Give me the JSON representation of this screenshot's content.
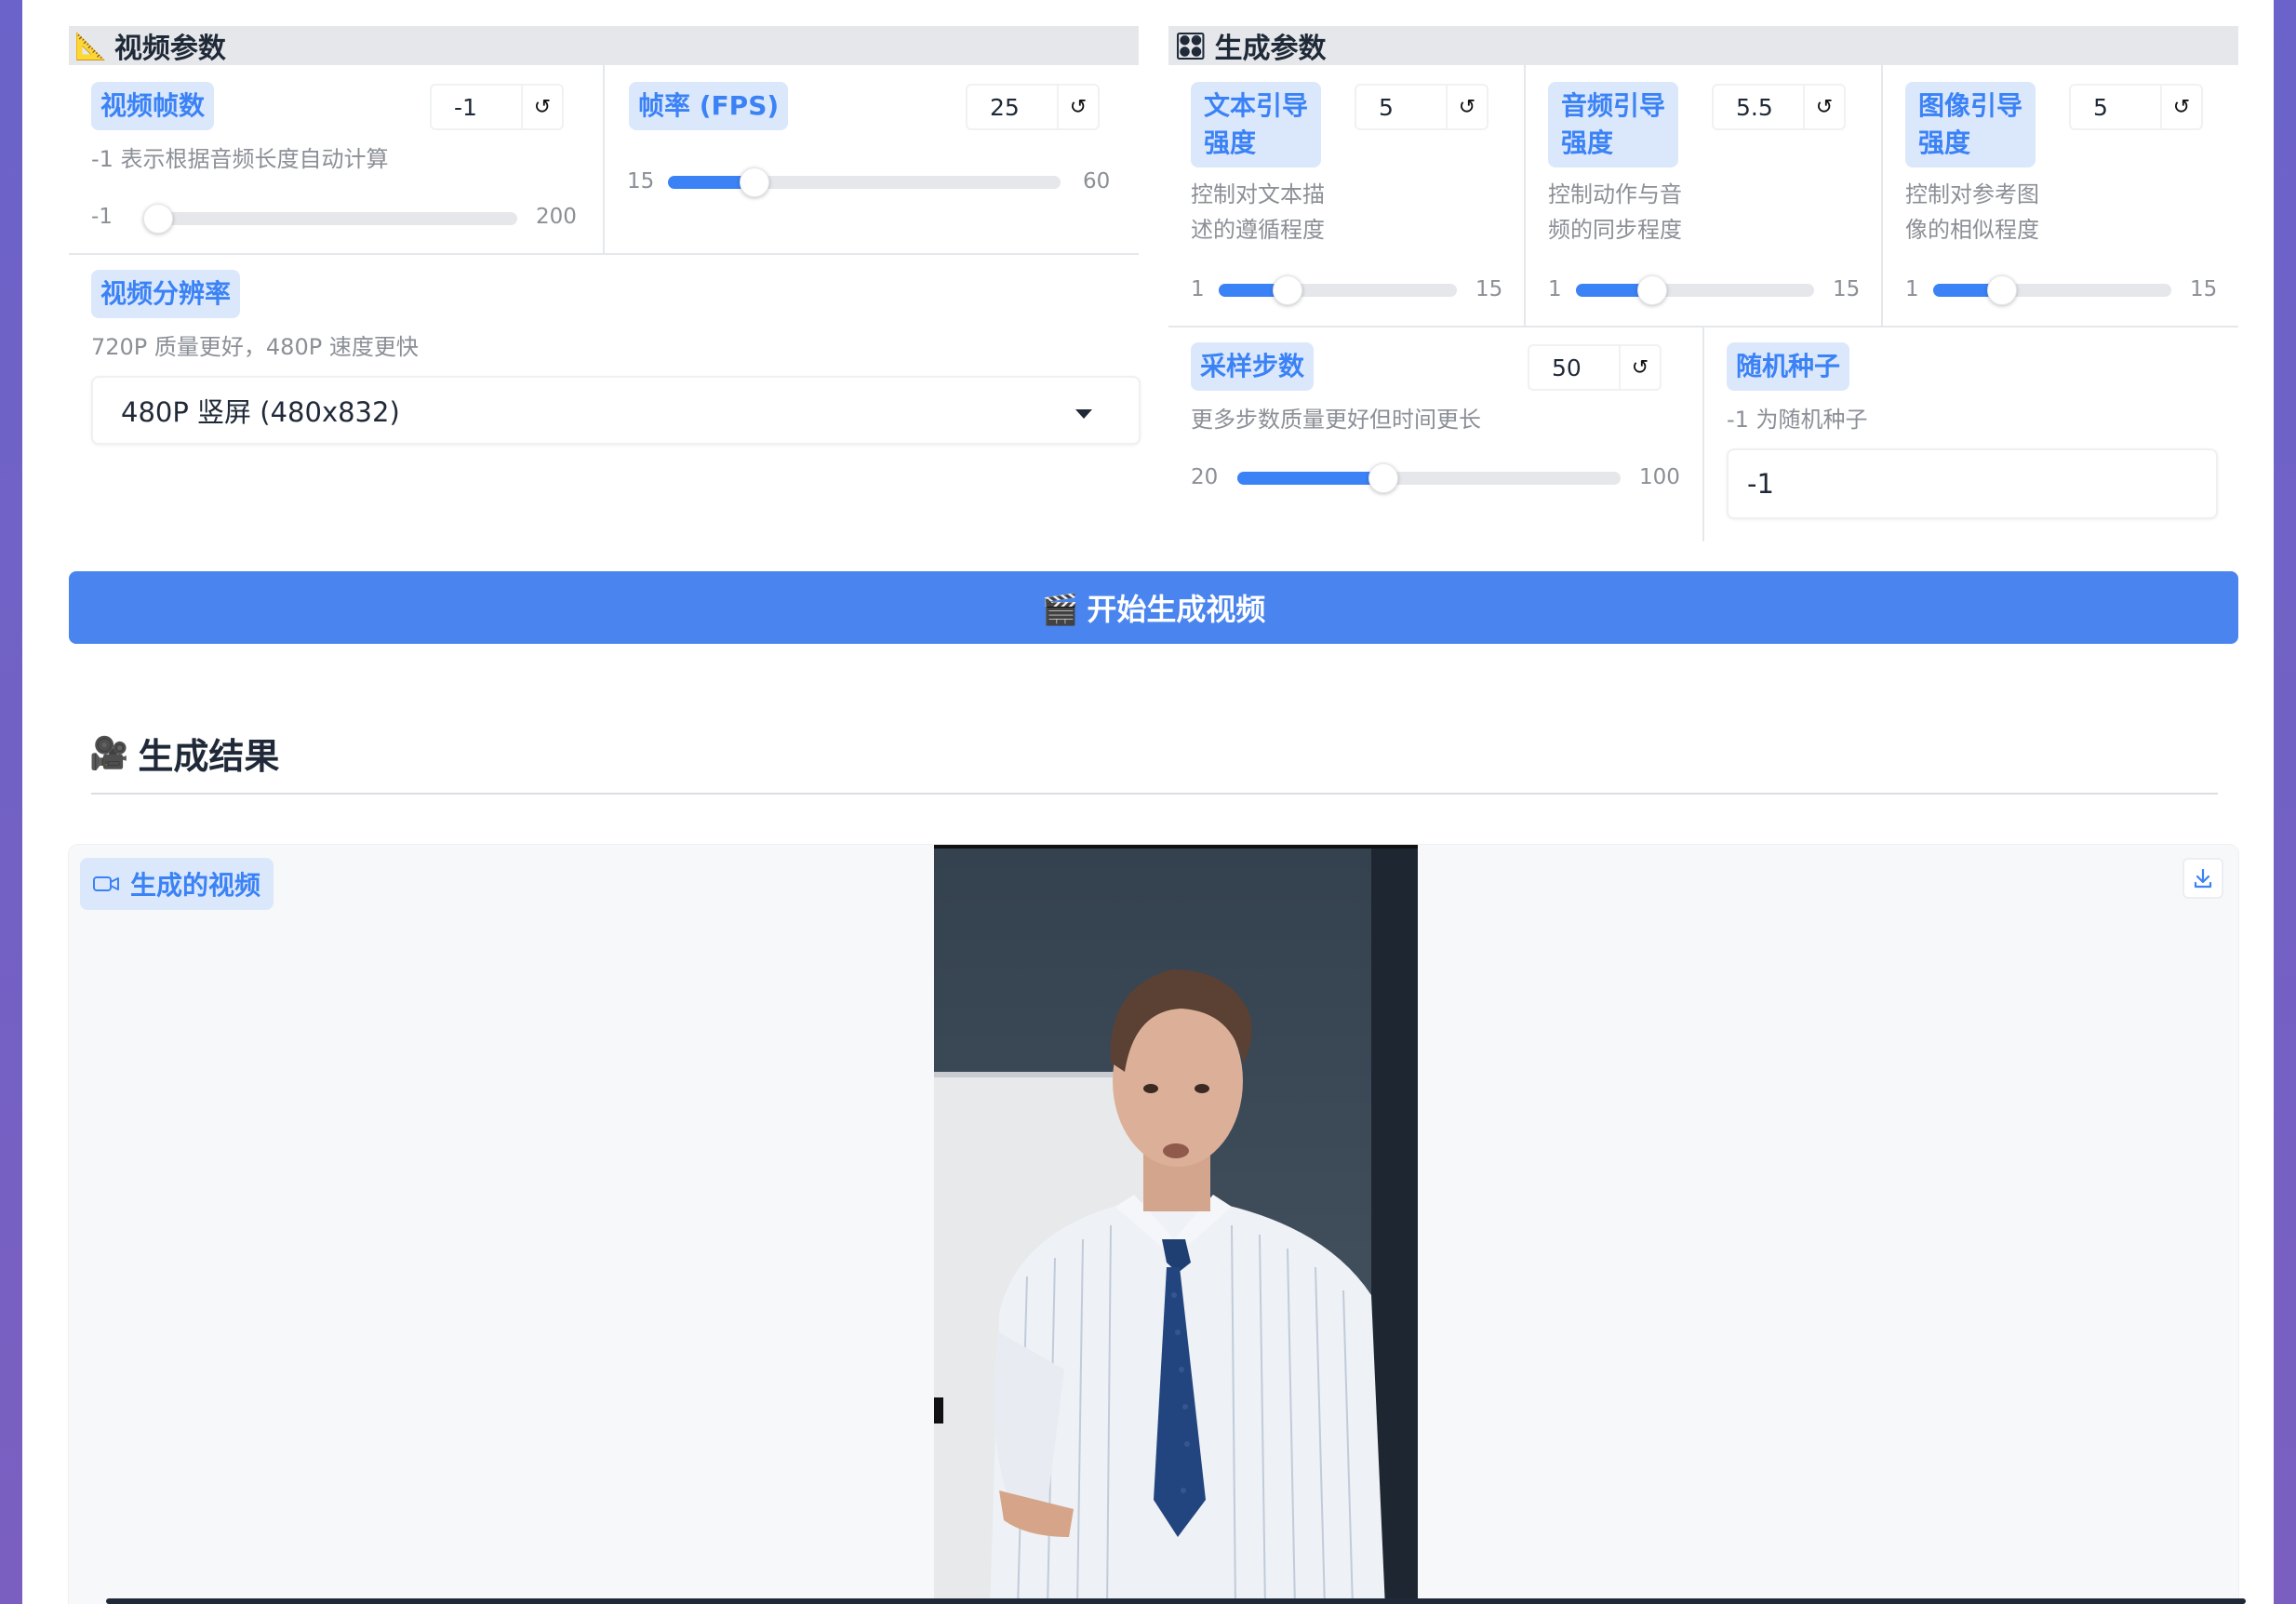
{
  "video_params": {
    "title": "视频参数",
    "icon": "ruler-icon",
    "frames": {
      "label": "视频帧数",
      "value": "-1",
      "reset": "↺",
      "desc": "-1 表示根据音频长度自动计算",
      "min": "-1",
      "max": "200",
      "fraction": 0.0
    },
    "fps": {
      "label": "帧率 (FPS)",
      "value": "25",
      "reset": "↺",
      "min": "15",
      "max": "60",
      "fraction": 0.22
    },
    "resolution": {
      "label": "视频分辨率",
      "desc": "720P 质量更好，480P 速度更快",
      "selected": "480P 竖屏 (480x832)"
    }
  },
  "gen_params": {
    "title": "生成参数",
    "icon": "control-knobs-icon",
    "text_guidance": {
      "label_l1": "文本引导",
      "label_l2": "强度",
      "value": "5",
      "reset": "↺",
      "desc_l1": "控制对文本描",
      "desc_l2": "述的遵循程度",
      "min": "1",
      "max": "15",
      "fraction": 0.29
    },
    "audio_guidance": {
      "label_l1": "音频引导",
      "label_l2": "强度",
      "value": "5.5",
      "reset": "↺",
      "desc_l1": "控制动作与音",
      "desc_l2": "频的同步程度",
      "min": "1",
      "max": "15",
      "fraction": 0.32
    },
    "image_guidance": {
      "label_l1": "图像引导",
      "label_l2": "强度",
      "value": "5",
      "reset": "↺",
      "desc_l1": "控制对参考图",
      "desc_l2": "像的相似程度",
      "min": "1",
      "max": "15",
      "fraction": 0.29
    },
    "steps": {
      "label": "采样步数",
      "value": "50",
      "reset": "↺",
      "desc": "更多步数质量更好但时间更长",
      "min": "20",
      "max": "100",
      "fraction": 0.38
    },
    "seed": {
      "label": "随机种子",
      "desc": "-1 为随机种子",
      "value": "-1"
    }
  },
  "generate_button": {
    "label": "🎬 开始生成视频"
  },
  "result": {
    "title": "生成结果",
    "icon": "video-camera-icon",
    "video_label": "生成的视频"
  },
  "colors": {
    "accent": "#4a84ee",
    "badge_bg": "#dbe8fb",
    "badge_text": "#3b82f6",
    "page_bg": "#6b63c9"
  }
}
